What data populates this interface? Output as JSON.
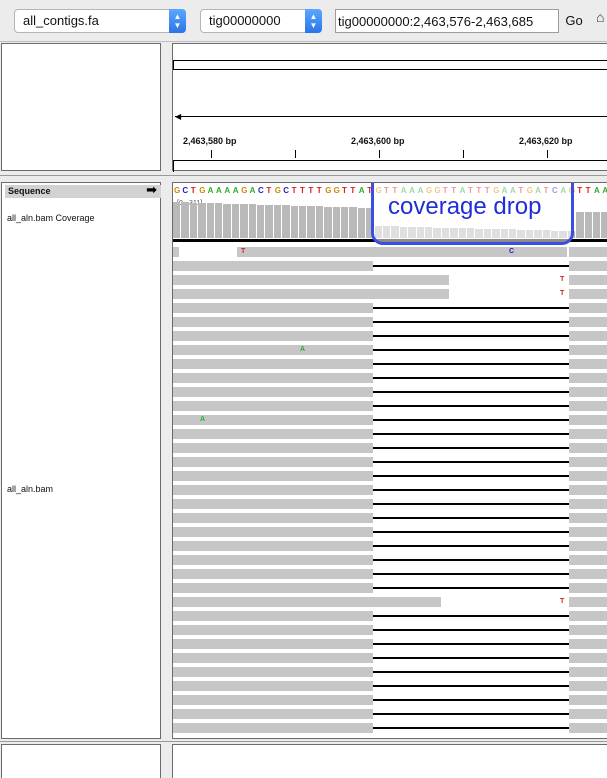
{
  "toolbar": {
    "genome_select": "all_contigs.fa",
    "chrom_select": "tig00000000",
    "locus": "tig00000000:2,463,576-2,463,685",
    "go_label": "Go"
  },
  "ruler": {
    "labels": [
      "2,463,580 bp",
      "2,463,600 bp",
      "2,463,620 bp"
    ]
  },
  "tracks": {
    "sequence_label": "Sequence",
    "coverage_label": "all_aln.bam Coverage",
    "coverage_range": "[0 - 311]",
    "alignment_label": "all_aln.bam"
  },
  "sequence": "GCTGAAAAGACTGCTTTTGGTTATGTTAAAGGTTATTTGAATGATCAGTTAA",
  "annotation": {
    "text": "coverage drop",
    "color": "#1f2fd6"
  },
  "mismatches": {
    "t": "T",
    "c": "C",
    "a": "A"
  },
  "colors": {
    "A": "#2faa2f",
    "C": "#2020c8",
    "G": "#d18a00",
    "T": "#d42020",
    "read": "#c6c6c6"
  }
}
